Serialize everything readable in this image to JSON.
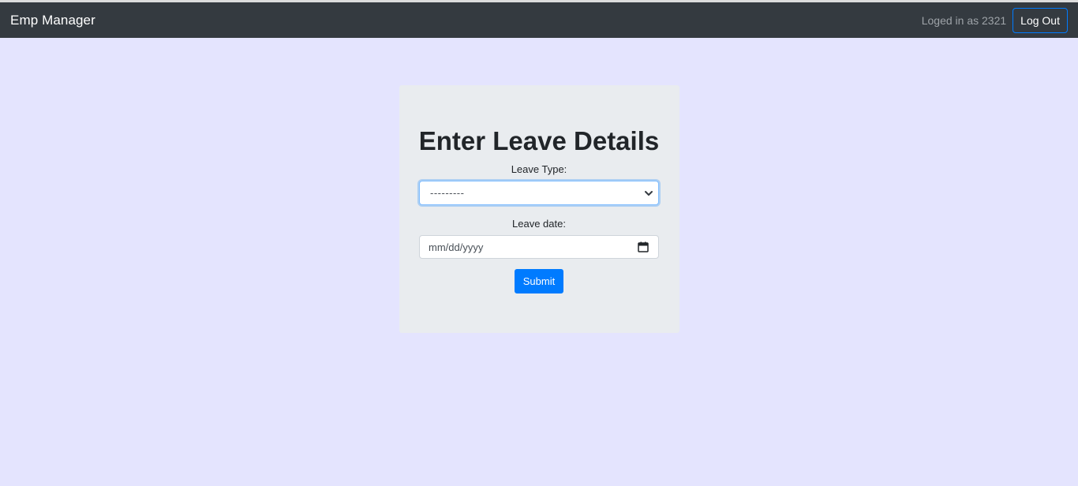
{
  "navbar": {
    "brand": "Emp Manager",
    "login_status": "Loged in as 2321",
    "logout_label": "Log Out"
  },
  "form": {
    "title": "Enter Leave Details",
    "leave_type_label": "Leave Type:",
    "leave_type_value": "---------",
    "leave_date_label": "Leave date:",
    "leave_date_placeholder": "mm/dd/yyyy",
    "submit_label": "Submit"
  },
  "colors": {
    "page_background": "#e4e4fe",
    "navbar": "#343a40",
    "card": "#e9ecef",
    "accent": "#007bff"
  },
  "icons": {
    "select_arrow": "chevron-down-icon",
    "date_picker": "calendar-icon"
  }
}
